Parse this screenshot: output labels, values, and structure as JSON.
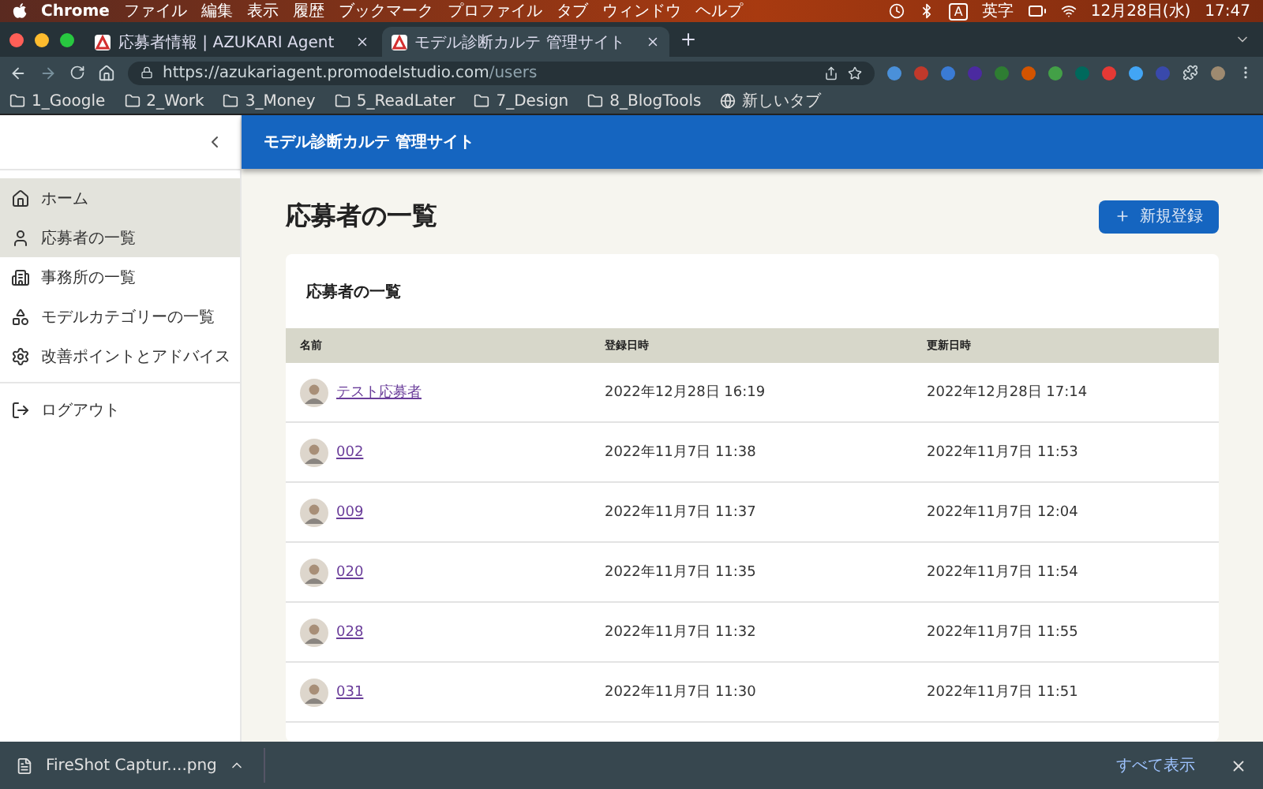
{
  "menu_bar": {
    "app": "Chrome",
    "items": [
      "ファイル",
      "編集",
      "表示",
      "履歴",
      "ブックマーク",
      "プロファイル",
      "タブ",
      "ウィンドウ",
      "ヘルプ"
    ],
    "input_badge": "A",
    "input_label": "英字",
    "date": "12月28日(水)",
    "time": "17:47"
  },
  "tabs": [
    {
      "title": "応募者情報 | AZUKARI Agent",
      "selected": false
    },
    {
      "title": "モデル診断カルテ 管理サイト",
      "selected": true
    }
  ],
  "address_bar": {
    "url_host": "https://azukariagent.promodelstudio.com",
    "url_path": "/users"
  },
  "bookmarks": [
    {
      "label": "1_Google",
      "kind": "folder"
    },
    {
      "label": "2_Work",
      "kind": "folder"
    },
    {
      "label": "3_Money",
      "kind": "folder"
    },
    {
      "label": "5_ReadLater",
      "kind": "folder"
    },
    {
      "label": "7_Design",
      "kind": "folder"
    },
    {
      "label": "8_BlogTools",
      "kind": "folder"
    },
    {
      "label": "新しいタブ",
      "kind": "page"
    }
  ],
  "sidebar": {
    "items": [
      {
        "label": "ホーム",
        "selected": true
      },
      {
        "label": "応募者の一覧",
        "selected": true
      },
      {
        "label": "事務所の一覧",
        "selected": false
      },
      {
        "label": "モデルカテゴリーの一覧",
        "selected": false
      },
      {
        "label": "改善ポイントとアドバイス",
        "selected": false
      }
    ],
    "footer_items": [
      {
        "label": "ログアウト"
      }
    ]
  },
  "header": {
    "title": "モデル診断カルテ 管理サイト"
  },
  "page_title": "応募者の一覧",
  "new_button": "新規登録",
  "card": {
    "title": "応募者の一覧",
    "columns": [
      "名前",
      "登録日時",
      "更新日時"
    ],
    "rows": [
      {
        "name": "テスト応募者",
        "registered": "2022年12月28日 16:19",
        "updated": "2022年12月28日 17:14"
      },
      {
        "name": "002",
        "registered": "2022年11月7日 11:38",
        "updated": "2022年11月7日 11:53"
      },
      {
        "name": "009",
        "registered": "2022年11月7日 11:37",
        "updated": "2022年11月7日 12:04"
      },
      {
        "name": "020",
        "registered": "2022年11月7日 11:35",
        "updated": "2022年11月7日 11:54"
      },
      {
        "name": "028",
        "registered": "2022年11月7日 11:32",
        "updated": "2022年11月7日 11:55"
      },
      {
        "name": "031",
        "registered": "2022年11月7日 11:30",
        "updated": "2022年11月7日 11:51"
      }
    ]
  },
  "download_bar": {
    "file": "FireShot Captur....png",
    "show_all": "すべて表示"
  }
}
